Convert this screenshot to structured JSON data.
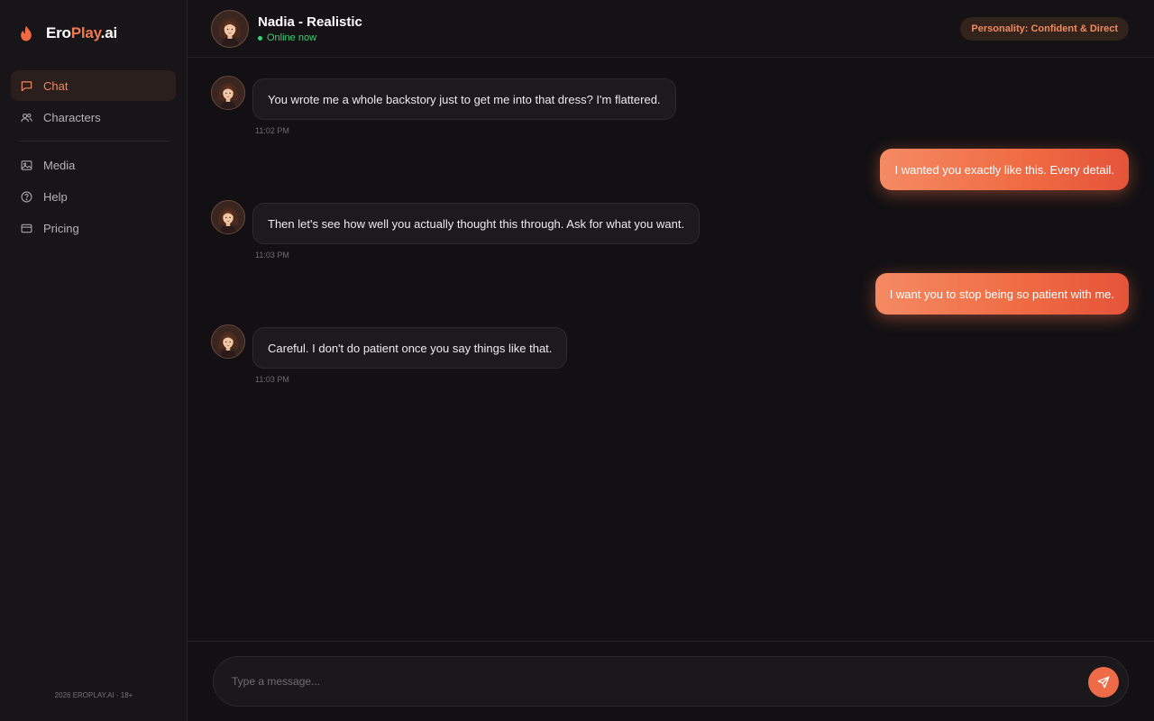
{
  "brand": {
    "part1": "Ero",
    "part2": "Play",
    "part3": ".ai"
  },
  "sidebar": {
    "items": [
      {
        "label": "Chat",
        "icon": "chat-icon",
        "active": true
      },
      {
        "label": "Characters",
        "icon": "users-icon",
        "active": false
      },
      {
        "label": "Media",
        "icon": "image-icon",
        "active": false
      },
      {
        "label": "Help",
        "icon": "help-icon",
        "active": false
      },
      {
        "label": "Pricing",
        "icon": "credit-card-icon",
        "active": false
      }
    ],
    "footer": "2026 EROPLAY.AI · 18+"
  },
  "header": {
    "name": "Nadia - Realistic",
    "status": "Online now",
    "personality": "Personality: Confident & Direct"
  },
  "messages": [
    {
      "from": "character",
      "text": "You wrote me a whole backstory just to get me into that dress? I'm flattered.",
      "time": "11:02 PM"
    },
    {
      "from": "user",
      "text": "I wanted you exactly like this. Every detail."
    },
    {
      "from": "character",
      "text": "Then let's see how well you actually thought this through. Ask for what you want.",
      "time": "11:03 PM"
    },
    {
      "from": "user",
      "text": "I want you to stop being so patient with me."
    },
    {
      "from": "character",
      "text": "Careful. I don't do patient once you say things like that.",
      "time": "11:03 PM"
    }
  ],
  "composer": {
    "placeholder": "Type a message..."
  },
  "colors": {
    "accent": "#ef6a42",
    "online": "#36d179",
    "background": "#121013"
  }
}
